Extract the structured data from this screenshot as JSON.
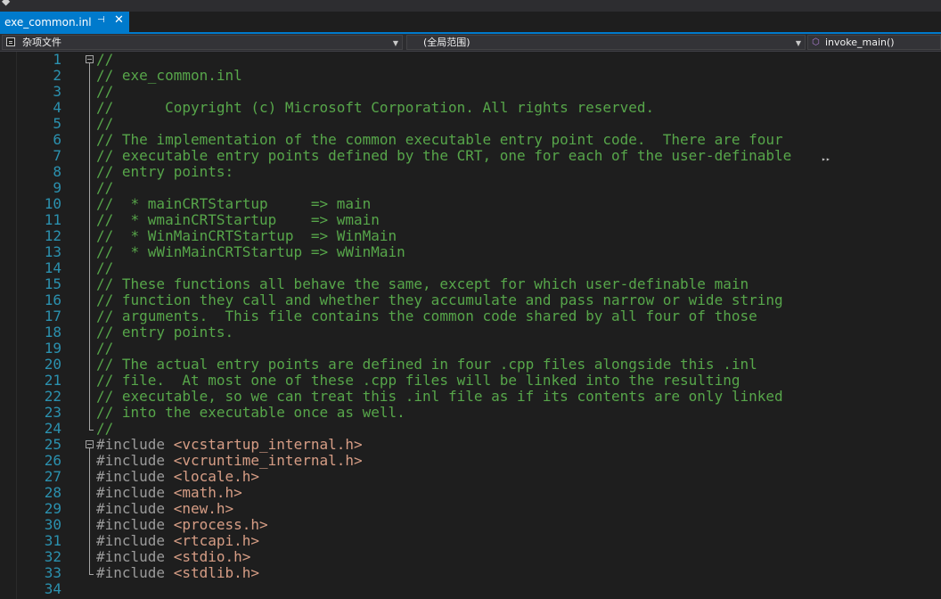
{
  "tab": {
    "title": "exe_common.inl",
    "pin_icon": "pin-icon",
    "close_icon": "close-icon"
  },
  "navbar": {
    "project": "杂项文件",
    "scope": "(全局范围)",
    "member": "invoke_main()"
  },
  "colors": {
    "accent": "#007acc",
    "comment": "#57a64a",
    "preprocessor": "#9b9b9b",
    "include_string": "#d69d85",
    "line_number": "#2b91af",
    "background": "#1e1e1e"
  },
  "lines": [
    {
      "n": "1",
      "parts": [
        {
          "t": "//",
          "k": "c"
        }
      ]
    },
    {
      "n": "2",
      "parts": [
        {
          "t": "// exe_common.inl",
          "k": "c"
        }
      ]
    },
    {
      "n": "3",
      "parts": [
        {
          "t": "//",
          "k": "c"
        }
      ]
    },
    {
      "n": "4",
      "parts": [
        {
          "t": "//      Copyright (c) Microsoft Corporation. All rights reserved.",
          "k": "c"
        }
      ]
    },
    {
      "n": "5",
      "parts": [
        {
          "t": "//",
          "k": "c"
        }
      ]
    },
    {
      "n": "6",
      "parts": [
        {
          "t": "// The implementation of the common executable entry point code.  There are four",
          "k": "c"
        }
      ]
    },
    {
      "n": "7",
      "parts": [
        {
          "t": "// executable entry points defined by the CRT, one for each of the user-definable",
          "k": "c"
        }
      ]
    },
    {
      "n": "8",
      "parts": [
        {
          "t": "// entry points:",
          "k": "c"
        }
      ]
    },
    {
      "n": "9",
      "parts": [
        {
          "t": "//",
          "k": "c"
        }
      ]
    },
    {
      "n": "10",
      "parts": [
        {
          "t": "//  * mainCRTStartup     => main",
          "k": "c"
        }
      ]
    },
    {
      "n": "11",
      "parts": [
        {
          "t": "//  * wmainCRTStartup    => wmain",
          "k": "c"
        }
      ]
    },
    {
      "n": "12",
      "parts": [
        {
          "t": "//  * WinMainCRTStartup  => WinMain",
          "k": "c"
        }
      ]
    },
    {
      "n": "13",
      "parts": [
        {
          "t": "//  * wWinMainCRTStartup => wWinMain",
          "k": "c"
        }
      ]
    },
    {
      "n": "14",
      "parts": [
        {
          "t": "//",
          "k": "c"
        }
      ]
    },
    {
      "n": "15",
      "parts": [
        {
          "t": "// These functions all behave the same, except for which user-definable main",
          "k": "c"
        }
      ]
    },
    {
      "n": "16",
      "parts": [
        {
          "t": "// function they call and whether they accumulate and pass narrow or wide string",
          "k": "c"
        }
      ]
    },
    {
      "n": "17",
      "parts": [
        {
          "t": "// arguments.  This file contains the common code shared by all four of those",
          "k": "c"
        }
      ]
    },
    {
      "n": "18",
      "parts": [
        {
          "t": "// entry points.",
          "k": "c"
        }
      ]
    },
    {
      "n": "19",
      "parts": [
        {
          "t": "//",
          "k": "c"
        }
      ]
    },
    {
      "n": "20",
      "parts": [
        {
          "t": "// The actual entry points are defined in four .cpp files alongside this .inl",
          "k": "c"
        }
      ]
    },
    {
      "n": "21",
      "parts": [
        {
          "t": "// file.  At most one of these .cpp files will be linked into the resulting",
          "k": "c"
        }
      ]
    },
    {
      "n": "22",
      "parts": [
        {
          "t": "// executable, so we can treat this .inl file as if its contents are only linked",
          "k": "c"
        }
      ]
    },
    {
      "n": "23",
      "parts": [
        {
          "t": "// into the executable once as well.",
          "k": "c"
        }
      ]
    },
    {
      "n": "24",
      "parts": [
        {
          "t": "//",
          "k": "c"
        }
      ]
    },
    {
      "n": "25",
      "parts": [
        {
          "t": "#include ",
          "k": "pp"
        },
        {
          "t": "<vcstartup_internal.h>",
          "k": "inc"
        }
      ]
    },
    {
      "n": "26",
      "parts": [
        {
          "t": "#include ",
          "k": "pp"
        },
        {
          "t": "<vcruntime_internal.h>",
          "k": "inc"
        }
      ]
    },
    {
      "n": "27",
      "parts": [
        {
          "t": "#include ",
          "k": "pp"
        },
        {
          "t": "<locale.h>",
          "k": "inc"
        }
      ]
    },
    {
      "n": "28",
      "parts": [
        {
          "t": "#include ",
          "k": "pp"
        },
        {
          "t": "<math.h>",
          "k": "inc"
        }
      ]
    },
    {
      "n": "29",
      "parts": [
        {
          "t": "#include ",
          "k": "pp"
        },
        {
          "t": "<new.h>",
          "k": "inc"
        }
      ]
    },
    {
      "n": "30",
      "parts": [
        {
          "t": "#include ",
          "k": "pp"
        },
        {
          "t": "<process.h>",
          "k": "inc"
        }
      ]
    },
    {
      "n": "31",
      "parts": [
        {
          "t": "#include ",
          "k": "pp"
        },
        {
          "t": "<rtcapi.h>",
          "k": "inc"
        }
      ]
    },
    {
      "n": "32",
      "parts": [
        {
          "t": "#include ",
          "k": "pp"
        },
        {
          "t": "<stdio.h>",
          "k": "inc"
        }
      ]
    },
    {
      "n": "33",
      "parts": [
        {
          "t": "#include ",
          "k": "pp"
        },
        {
          "t": "<stdlib.h>",
          "k": "inc"
        }
      ]
    },
    {
      "n": "34",
      "parts": []
    }
  ]
}
